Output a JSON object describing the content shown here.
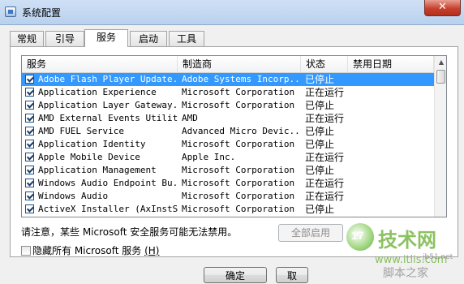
{
  "window": {
    "title": "系统配置",
    "close_glyph": "✕"
  },
  "tabs": [
    {
      "label": "常规"
    },
    {
      "label": "引导"
    },
    {
      "label": "服务"
    },
    {
      "label": "启动"
    },
    {
      "label": "工具"
    }
  ],
  "active_tab": "服务",
  "table": {
    "columns": [
      "服务",
      "制造商",
      "状态",
      "禁用日期"
    ],
    "rows": [
      {
        "service": "Adobe Flash Player Update...",
        "vendor": "Adobe Systems Incorp...",
        "status": "已停止",
        "checked": true,
        "selected": true
      },
      {
        "service": "Application Experience",
        "vendor": "Microsoft Corporation",
        "status": "正在运行",
        "checked": true
      },
      {
        "service": "Application Layer Gateway...",
        "vendor": "Microsoft Corporation",
        "status": "已停止",
        "checked": true
      },
      {
        "service": "AMD External Events Utility",
        "vendor": "AMD",
        "status": "正在运行",
        "checked": true
      },
      {
        "service": "AMD FUEL Service",
        "vendor": "Advanced Micro Devic...",
        "status": "已停止",
        "checked": true
      },
      {
        "service": "Application Identity",
        "vendor": "Microsoft Corporation",
        "status": "已停止",
        "checked": true
      },
      {
        "service": "Apple Mobile Device",
        "vendor": "Apple Inc.",
        "status": "正在运行",
        "checked": true
      },
      {
        "service": "Application Management",
        "vendor": "Microsoft Corporation",
        "status": "已停止",
        "checked": true
      },
      {
        "service": "Windows Audio Endpoint Bu...",
        "vendor": "Microsoft Corporation",
        "status": "正在运行",
        "checked": true
      },
      {
        "service": "Windows Audio",
        "vendor": "Microsoft Corporation",
        "status": "正在运行",
        "checked": true
      },
      {
        "service": "ActiveX Installer (AxInstSV)",
        "vendor": "Microsoft Corporation",
        "status": "已停止",
        "checked": true
      }
    ]
  },
  "notice": "请注意，某些 Microsoft 安全服务可能无法禁用。",
  "buttons": {
    "enable_all": "全部启用",
    "ok": "确定",
    "cancel": "取"
  },
  "hide_ms_label": "隐藏所有 Microsoft 服务",
  "hide_ms_hotkey": "(H)",
  "hide_ms_checked": false,
  "watermark": {
    "brand": "技术网",
    "url": "www.itlis.com",
    "site": "脚本之家",
    "site_url": "jb51.net"
  }
}
